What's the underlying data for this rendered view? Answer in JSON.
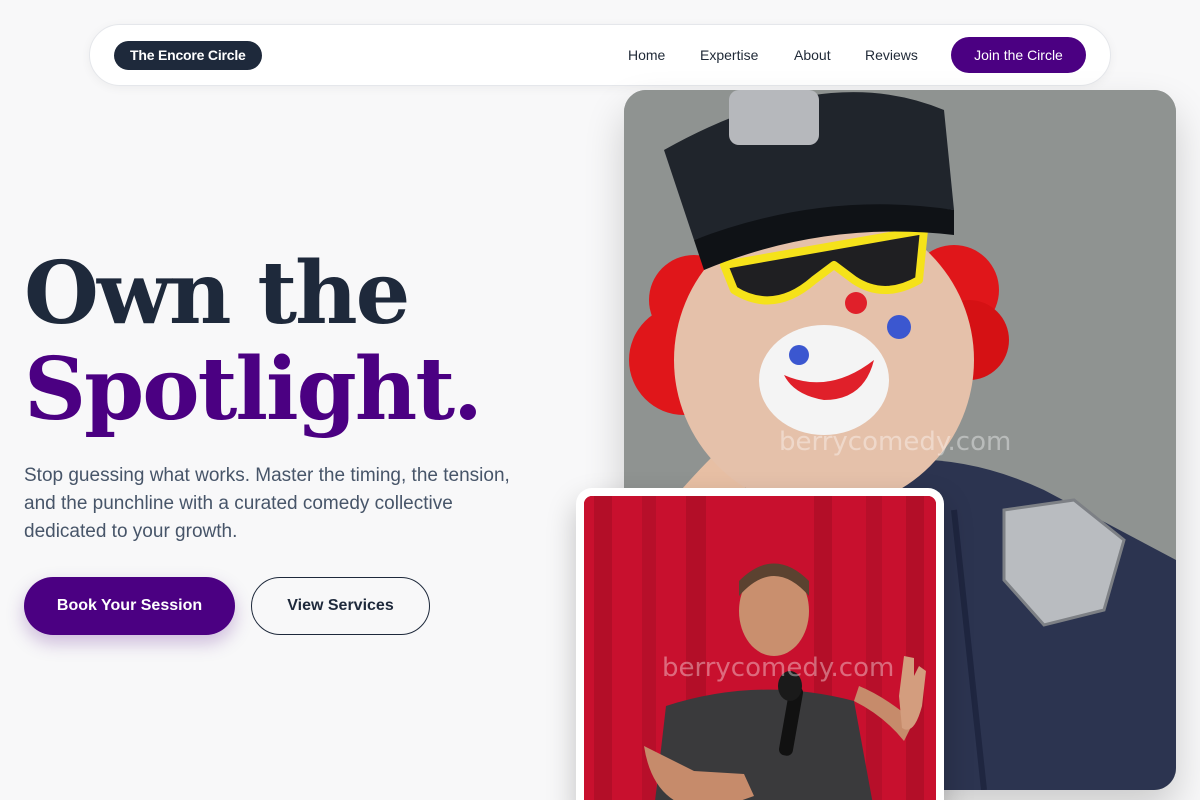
{
  "nav": {
    "brand": "The Encore Circle",
    "links": [
      "Home",
      "Expertise",
      "About",
      "Reviews"
    ],
    "cta": "Join the Circle"
  },
  "hero": {
    "headline_line1": "Own the",
    "headline_line2": "Spotlight.",
    "subtext": "Stop guessing what works. Master the timing, the tension, and the punchline with a curated comedy collective dedicated to your growth.",
    "primary_button": "Book Your Session",
    "secondary_button": "View Services"
  },
  "images": {
    "main_watermark": "berrycomedy.com",
    "secondary_watermark": "berrycomedy.com"
  },
  "colors": {
    "accent": "#4b0082",
    "dark": "#1e293b",
    "background": "#f8f8f9"
  }
}
